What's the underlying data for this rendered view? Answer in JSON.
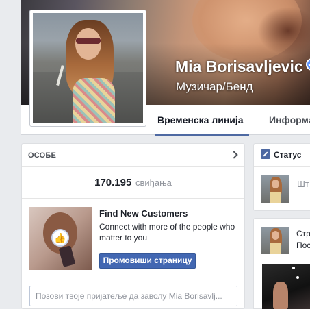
{
  "profile": {
    "name": "Mia Borisavljevic",
    "category": "Музичар/Бенд",
    "verified": true
  },
  "tabs": [
    {
      "label": "Временска линија",
      "active": true
    },
    {
      "label": "Информа",
      "active": false
    }
  ],
  "people": {
    "heading": "ОСОБЕ",
    "likes_count": "170.195",
    "likes_label": "свиђања"
  },
  "ad": {
    "title": "Find New Customers",
    "text": "Connect with more of the people who matter to you",
    "button": "Промовиши страницу"
  },
  "invite": {
    "placeholder": "Позови твоје пријатеље да заволу Mia Borisavlj..."
  },
  "composer": {
    "status_tab": "Статус",
    "placeholder": "Шт"
  },
  "feed": {
    "line1": "Стр",
    "line2": "Пос"
  },
  "colors": {
    "accent": "#4267b2",
    "verified": "#5890ff",
    "tab_underline": "#4e69a2"
  }
}
